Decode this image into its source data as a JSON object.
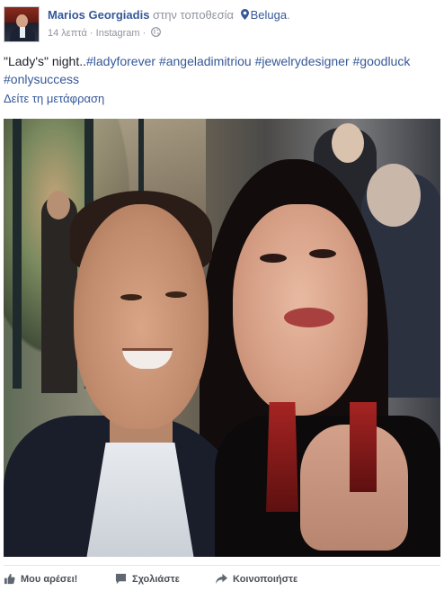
{
  "post": {
    "author": "Marios Georgiadis",
    "at_text": "στην τοποθεσία",
    "location": "Beluga",
    "location_suffix": ".",
    "time": "14 λεπτά",
    "separator": "·",
    "source": "Instagram",
    "separator2": "·",
    "text_prefix": "\"Lady's\" night..",
    "hashtags": [
      "#ladyforever",
      "#angeladimitriou",
      "#jewelrydesigner",
      "#goodluck",
      "#onlysuccess"
    ],
    "see_translation": "Δείτε τη μετάφραση",
    "icons": {
      "location": "map-pin-icon",
      "privacy": "globe-icon"
    }
  },
  "actions": {
    "like_label": "Μου αρέσει!",
    "comment_label": "Σχολιάστε",
    "share_label": "Κοινοποιήστε",
    "icons": {
      "like": "thumbs-up-icon",
      "comment": "comment-icon",
      "share": "share-arrow-icon"
    }
  },
  "colors": {
    "link": "#365899",
    "meta": "#90949c",
    "text": "#1d2129"
  }
}
